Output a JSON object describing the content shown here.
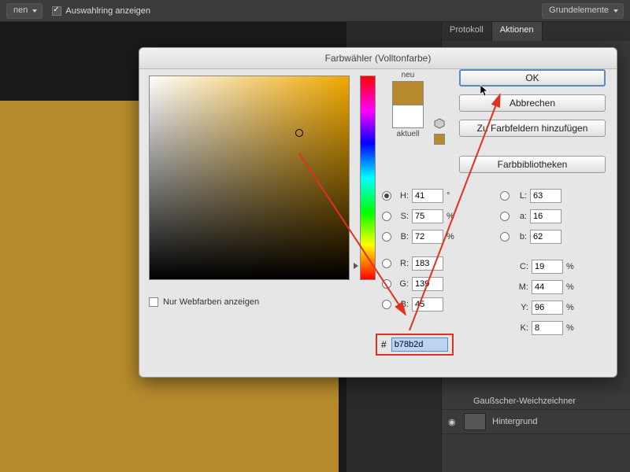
{
  "toolbar": {
    "dropdown": "nen",
    "checkbox_label": "Auswahlring anzeigen",
    "right_button": "Grundelemente"
  },
  "panel": {
    "tabs": [
      "Protokoll",
      "Aktionen"
    ],
    "layer1_text": "Gaußscher-Weichzeichner",
    "layer2_text": "Hintergrund"
  },
  "dialog": {
    "title": "Farbwähler (Volltonfarbe)",
    "new_label": "neu",
    "current_label": "aktuell",
    "ok": "OK",
    "cancel": "Abbrechen",
    "add_swatches": "Zu Farbfeldern hinzufügen",
    "color_libs": "Farbbibliotheken",
    "web_only": "Nur Webfarben anzeigen",
    "hex_value": "b78b2d",
    "hsb": {
      "h": "41",
      "s": "75",
      "b": "72"
    },
    "rgb": {
      "r": "183",
      "g": "139",
      "b": "45"
    },
    "lab": {
      "l": "63",
      "a": "16",
      "b": "62"
    },
    "cmyk": {
      "c": "19",
      "m": "44",
      "y": "96",
      "k": "8"
    },
    "labels": {
      "H": "H:",
      "S": "S:",
      "Bb": "B:",
      "R": "R:",
      "G": "G:",
      "B2": "B:",
      "L": "L:",
      "a": "a:",
      "b": "b:",
      "C": "C:",
      "M": "M:",
      "Y": "Y:",
      "K": "K:",
      "deg": "°",
      "pct": "%",
      "hash": "#"
    }
  }
}
